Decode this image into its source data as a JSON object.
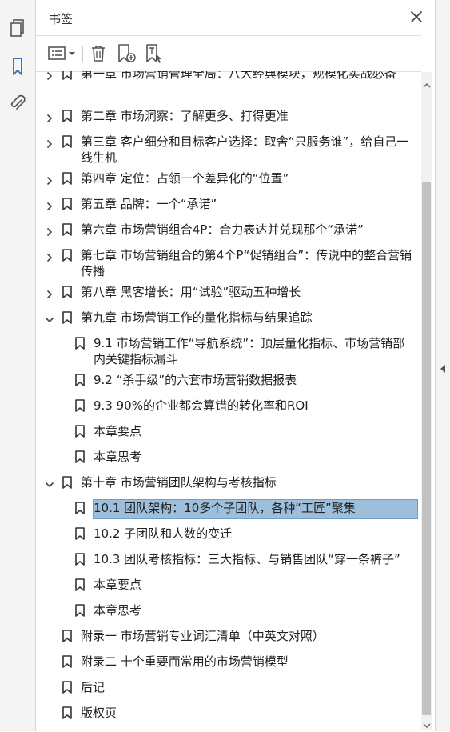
{
  "panel": {
    "title": "书签"
  },
  "icons": {
    "rail": [
      "pages-icon",
      "bookmarks-icon",
      "attachments-icon"
    ],
    "toolbar": [
      "options-menu-icon",
      "delete-bookmark-icon",
      "new-bookmark-icon",
      "bookmark-from-selection-icon"
    ]
  },
  "colors": {
    "accent": "#2a6ab8",
    "selection": "#9dbfdc"
  },
  "bookmarks": [
    {
      "label": "第一章 市场营销管理全局：八大经典模块，规模化实战必备",
      "level": 0,
      "expander": "collapsed"
    },
    {
      "label": "第二章 市场洞察：了解更多、打得更准",
      "level": 0,
      "expander": "collapsed"
    },
    {
      "label": "第三章 客户细分和目标客户选择：取舍“只服务谁”，给自己一线生机",
      "level": 0,
      "expander": "collapsed"
    },
    {
      "label": "第四章 定位：占领一个差异化的“位置”",
      "level": 0,
      "expander": "collapsed"
    },
    {
      "label": "第五章 品牌：一个“承诺”",
      "level": 0,
      "expander": "collapsed"
    },
    {
      "label": "第六章 市场营销组合4P：合力表达并兑现那个“承诺”",
      "level": 0,
      "expander": "collapsed"
    },
    {
      "label": "第七章 市场营销组合的第4个P“促销组合”：传说中的整合营销传播",
      "level": 0,
      "expander": "collapsed"
    },
    {
      "label": "第八章 黑客增长：用“试验”驱动五种增长",
      "level": 0,
      "expander": "collapsed"
    },
    {
      "label": "第九章 市场营销工作的量化指标与结果追踪",
      "level": 0,
      "expander": "expanded"
    },
    {
      "label": "9.1 市场营销工作“导航系统”：顶层量化指标、市场营销部内关键指标漏斗",
      "level": 1,
      "expander": "none"
    },
    {
      "label": "9.2 “杀手级”的六套市场营销数据报表",
      "level": 1,
      "expander": "none"
    },
    {
      "label": "9.3 90%的企业都会算错的转化率和ROI",
      "level": 1,
      "expander": "none"
    },
    {
      "label": "本章要点",
      "level": 1,
      "expander": "none"
    },
    {
      "label": "本章思考",
      "level": 1,
      "expander": "none"
    },
    {
      "label": "第十章 市场营销团队架构与考核指标",
      "level": 0,
      "expander": "expanded"
    },
    {
      "label": "10.1 团队架构：10多个子团队，各种“工匠”聚集",
      "level": 1,
      "expander": "none",
      "selected": true
    },
    {
      "label": "10.2 子团队和人数的变迁",
      "level": 1,
      "expander": "none"
    },
    {
      "label": "10.3 团队考核指标：三大指标、与销售团队“穿一条裤子”",
      "level": 1,
      "expander": "none"
    },
    {
      "label": "本章要点",
      "level": 1,
      "expander": "none"
    },
    {
      "label": "本章思考",
      "level": 1,
      "expander": "none"
    },
    {
      "label": "附录一 市场营销专业词汇清单（中英文对照）",
      "level": 0,
      "expander": "none"
    },
    {
      "label": "附录二 十个重要而常用的市场营销模型",
      "level": 0,
      "expander": "none"
    },
    {
      "label": "后记",
      "level": 0,
      "expander": "none"
    },
    {
      "label": "版权页",
      "level": 0,
      "expander": "none"
    }
  ]
}
